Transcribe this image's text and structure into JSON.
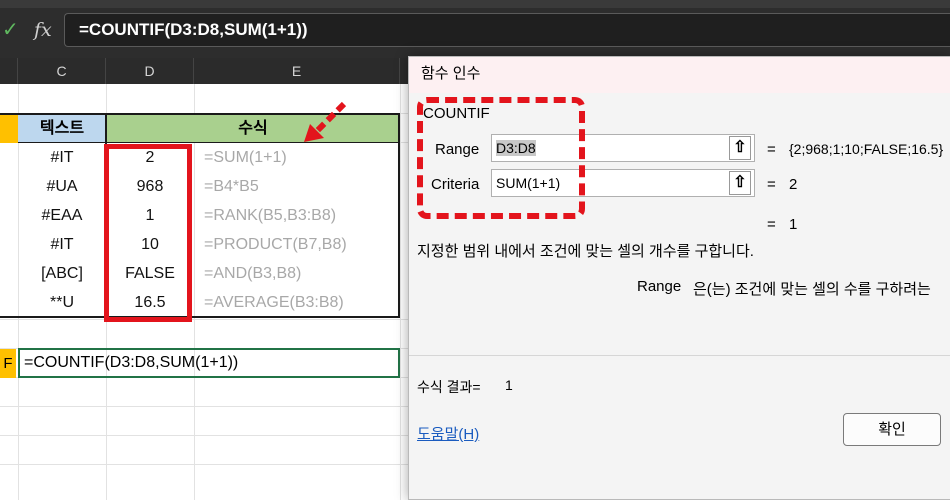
{
  "formula_bar": {
    "confirm_icon": "check-icon",
    "function_icon": "fx-icon",
    "fx_label": "fx",
    "formula": "=COUNTIF(D3:D8,SUM(1+1))"
  },
  "columns": [
    "C",
    "D",
    "E"
  ],
  "table": {
    "header_c": "텍스트",
    "header_e": "수식",
    "rows": [
      {
        "c": "#IT",
        "d": "2",
        "e": "=SUM(1+1)"
      },
      {
        "c": "#UA",
        "d": "968",
        "e": "=B4*B5"
      },
      {
        "c": "#EAA",
        "d": "1",
        "e": "=RANK(B5,B3:B8)"
      },
      {
        "c": "#IT",
        "d": "10",
        "e": "=PRODUCT(B7,B8)"
      },
      {
        "c": "[ABC]",
        "d": "FALSE",
        "e": "=AND(B3,B8)"
      },
      {
        "c": "**U",
        "d": "16.5",
        "e": "=AVERAGE(B3:B8)"
      }
    ]
  },
  "result_row": {
    "label": "F",
    "formula": "=COUNTIF(D3:D8,SUM(1+1))"
  },
  "dialog": {
    "title": "함수 인수",
    "function_name": "COUNTIF",
    "range_label": "Range",
    "range_value": "D3:D8",
    "range_result": "{2;968;1;10;FALSE;16.5}",
    "criteria_label": "Criteria",
    "criteria_value": "SUM(1+1)",
    "criteria_result": "2",
    "eq": "=",
    "overall_result": "1",
    "description": "지정한 범위 내에서 조건에 맞는 셀의 개수를 구합니다.",
    "arg_desc_name": "Range",
    "arg_desc_text": "은(는) 조건에 맞는 셀의 수를 구하려는",
    "formula_result_label": "수식 결과=",
    "formula_result_value": "1",
    "help_label": "도움말(H)",
    "ok_label": "확인"
  },
  "colors": {
    "highlight_red": "#e3141c",
    "header_green": "#a9d08e",
    "header_blue": "#bdd7ee",
    "accent_yellow": "#ffc000"
  }
}
